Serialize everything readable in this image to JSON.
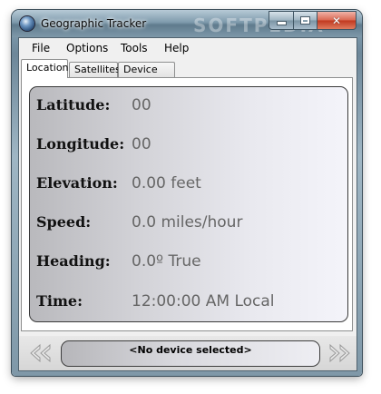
{
  "window": {
    "title": "Geographic Tracker",
    "watermark": "SOFTPEDIA"
  },
  "menu": {
    "items": [
      {
        "label": "File"
      },
      {
        "label": "Options"
      },
      {
        "label": "Tools"
      },
      {
        "label": "Help"
      }
    ]
  },
  "tabs": [
    {
      "label": "Location",
      "active": true
    },
    {
      "label": "Satellites",
      "active": false
    },
    {
      "label": "Device List",
      "active": false
    }
  ],
  "location": {
    "latitude": {
      "label": "Latitude:",
      "value": "00"
    },
    "longitude": {
      "label": "Longitude:",
      "value": "00"
    },
    "elevation": {
      "label": "Elevation:",
      "value": "0.00 feet"
    },
    "speed": {
      "label": "Speed:",
      "value": "0.0 miles/hour"
    },
    "heading": {
      "label": "Heading:",
      "value": "0.0º True"
    },
    "time": {
      "label": "Time:",
      "value": "12:00:00 AM Local"
    }
  },
  "footer": {
    "status": "<No device selected>",
    "prev_icon": "double-left-arrow-icon",
    "next_icon": "double-right-arrow-icon"
  },
  "colors": {
    "label_text": "#111111",
    "value_text": "#666666",
    "close_button": "#c0381f"
  }
}
